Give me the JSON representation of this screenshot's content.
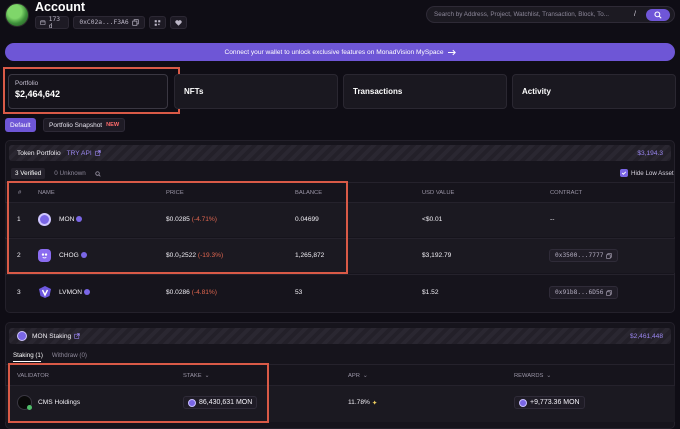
{
  "header": {
    "title": "Account",
    "age": "173 d",
    "address": "0xC02a...F3A6",
    "search_placeholder": "Search by Address, Project, Watchlist, Transaction, Block, To...",
    "slash": "/"
  },
  "banner": {
    "text": "Connect your wallet to unlock exclusive features on MonadVision MySpace"
  },
  "tabs": {
    "portfolio_label": "Portfolio",
    "portfolio_value": "$2,464,642",
    "nfts": "NFTs",
    "transactions": "Transactions",
    "activity": "Activity"
  },
  "view": {
    "default": "Default",
    "snapshot": "Portfolio Snapshot",
    "new": "NEW"
  },
  "token_portfolio": {
    "title": "Token Portfolio",
    "try_api": "TRY API",
    "total": "$3,194.3",
    "verified_tab": "3 Verified",
    "unknown_tab": "0 Unknown",
    "hide_low": "Hide Low Asset",
    "columns": [
      "#",
      "NAME",
      "PRICE",
      "BALANCE",
      "USD VALUE",
      "CONTRACT"
    ],
    "rows": [
      {
        "idx": "1",
        "name": "MON",
        "price": "$0.0285",
        "change": "(-4.71%)",
        "balance": "0.04699",
        "usd": "<$0.01",
        "contract": "--",
        "icon": "monad-icon",
        "icon_color": "#7a66e6"
      },
      {
        "idx": "2",
        "name": "CHOG",
        "price": "$0.0₂2522",
        "change": "(-19.3%)",
        "balance": "1,265,872",
        "usd": "$3,192.79",
        "contract": "0x3500...7777",
        "icon": "chog-icon",
        "icon_color": "#8a6cf0"
      },
      {
        "idx": "3",
        "name": "LVMON",
        "price": "$0.0286",
        "change": "(-4.81%)",
        "balance": "53",
        "usd": "$1.52",
        "contract": "0x91b8...6D56",
        "icon": "lvmon-icon",
        "icon_color": "#6d58e0"
      }
    ]
  },
  "staking": {
    "title": "MON Staking",
    "total": "$2,461,448",
    "tab_staking": "Staking (1)",
    "tab_withdraw": "Withdraw (0)",
    "columns": [
      "VALIDATOR",
      "STAKE",
      "APR",
      "REWARDS"
    ],
    "row": {
      "validator": "CMS Holdings",
      "stake": "86,430,631 MON",
      "apr": "11.78%",
      "rewards": "+9,773.36 MON"
    }
  },
  "colors": {
    "accent": "#6e56d6",
    "negative": "#e0664f",
    "highlight": "#d95a47"
  }
}
